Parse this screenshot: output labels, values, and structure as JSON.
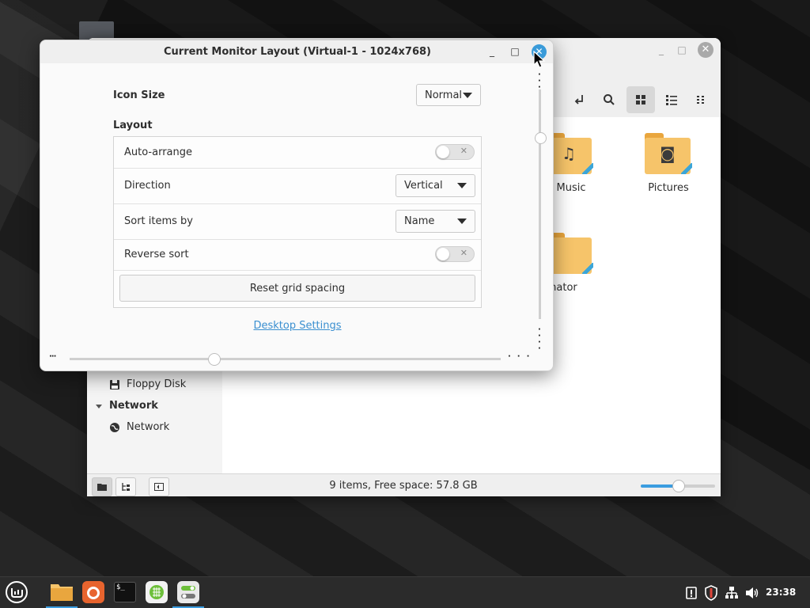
{
  "dialog": {
    "title": "Current Monitor Layout (Virtual-1 - 1024x768)",
    "icon_size_label": "Icon Size",
    "icon_size_value": "Normal",
    "layout_heading": "Layout",
    "rows": {
      "auto_arrange": {
        "label": "Auto-arrange",
        "enabled": false
      },
      "direction": {
        "label": "Direction",
        "value": "Vertical"
      },
      "sort_by": {
        "label": "Sort items by",
        "value": "Name"
      },
      "reverse_sort": {
        "label": "Reverse sort",
        "enabled": false
      }
    },
    "reset_button": "Reset grid spacing",
    "desktop_settings_link": "Desktop Settings",
    "window_buttons": {
      "minimize": "_",
      "maximize": "□",
      "close": "✕"
    }
  },
  "file_manager": {
    "folders": [
      {
        "label": "Music",
        "icon": "music-note-icon",
        "glyph": "♫"
      },
      {
        "label": "Pictures",
        "icon": "camera-icon",
        "glyph": "◙"
      },
      {
        "label": "arpinator",
        "icon": "folder-icon",
        "glyph": ""
      }
    ],
    "sidebar": {
      "floppy": "Floppy Disk",
      "network_heading": "Network",
      "network_item": "Network"
    },
    "status_text": "9 items, Free space: 57.8 GB",
    "zoom_level_fraction": 0.5,
    "window_buttons": {
      "minimize": "_",
      "maximize": "□",
      "close": "✕"
    }
  },
  "taskbar": {
    "apps": [
      "menu-icon",
      "files-icon",
      "firefox-icon",
      "terminal-icon",
      "software-manager-icon",
      "settings-icon"
    ],
    "terminal_glyph": "$_",
    "clock": "23:38"
  },
  "colors": {
    "accent": "#3b9de0",
    "folder": "#f6c46a",
    "taskbar": "#2b2b2b"
  }
}
